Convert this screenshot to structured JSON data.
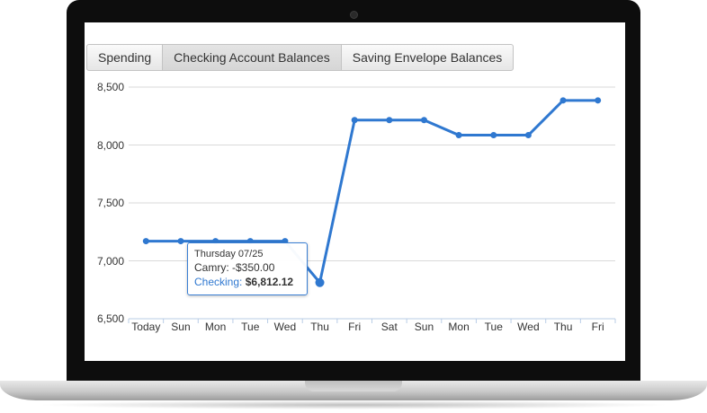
{
  "tabs": [
    {
      "label": "Spending",
      "active": false
    },
    {
      "label": "Checking Account Balances",
      "active": true
    },
    {
      "label": "Saving Envelope Balances",
      "active": false
    }
  ],
  "colors": {
    "accent": "#2f78d0",
    "tooltip_border": "#3a7fd4",
    "grid": "#d9d9d9"
  },
  "tooltip": {
    "date": "Thursday 07/25",
    "transaction_label": "Camry:",
    "transaction_value": "-$350.00",
    "series_label": "Checking:",
    "series_value": "$6,812.12"
  },
  "chart_data": {
    "type": "line",
    "categories": [
      "Today",
      "Sun",
      "Mon",
      "Tue",
      "Wed",
      "Thu",
      "Fri",
      "Sat",
      "Sun",
      "Mon",
      "Tue",
      "Wed",
      "Thu",
      "Fri"
    ],
    "series": [
      {
        "values": [
          7170,
          7170,
          7170,
          7170,
          7170,
          6812.12,
          8215,
          8215,
          8215,
          8085,
          8085,
          8085,
          8385,
          8385
        ]
      }
    ],
    "ylim": [
      6500,
      8500
    ],
    "y_ticks": [
      "6,500",
      "7,000",
      "7,500",
      "8,000",
      "8,500"
    ],
    "y_tick_values": [
      6500,
      7000,
      7500,
      8000,
      8500
    ],
    "grid": true,
    "highlighted_index": 5
  }
}
